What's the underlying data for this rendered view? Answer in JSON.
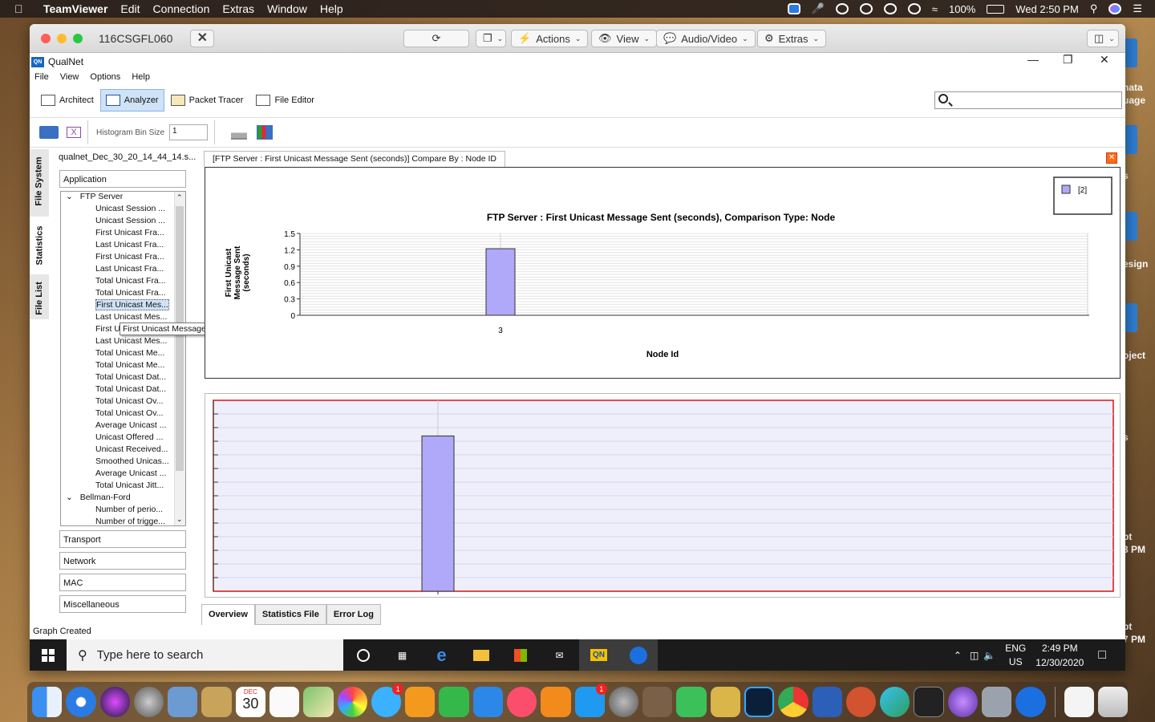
{
  "mac_menubar": {
    "app": "TeamViewer",
    "items": [
      "Edit",
      "Connection",
      "Extras",
      "Window",
      "Help"
    ],
    "battery": "100%",
    "clock": "Wed 2:50 PM"
  },
  "desktop_labels": [
    "nata",
    "uage",
    "s",
    "esign",
    "oject",
    "s",
    "pt",
    "3 PM",
    "pt",
    "7 PM"
  ],
  "teamviewer": {
    "title": "116CSGFL060",
    "toolbar": {
      "actions": "Actions",
      "view": "View",
      "audio_video": "Audio/Video",
      "extras": "Extras"
    }
  },
  "qualnet": {
    "title": "QualNet",
    "menu": [
      "File",
      "View",
      "Options",
      "Help"
    ],
    "tabs": [
      "Architect",
      "Analyzer",
      "Packet Tracer",
      "File Editor"
    ],
    "active_tab": "Analyzer",
    "histogram_label": "Histogram Bin Size",
    "histogram_value": "1",
    "vertical_tabs": [
      "File System",
      "Statistics",
      "File List"
    ],
    "file_name": "qualnet_Dec_30_20_14_44_14.s...",
    "sections": {
      "application": "Application",
      "transport": "Transport",
      "network": "Network",
      "mac": "MAC",
      "misc": "Miscellaneous"
    },
    "tree": [
      {
        "type": "grp",
        "label": "FTP Server"
      },
      {
        "type": "leaf",
        "label": "Unicast Session ..."
      },
      {
        "type": "leaf",
        "label": "Unicast Session ..."
      },
      {
        "type": "leaf",
        "label": "First Unicast Fra..."
      },
      {
        "type": "leaf",
        "label": "Last Unicast Fra..."
      },
      {
        "type": "leaf",
        "label": "First Unicast Fra..."
      },
      {
        "type": "leaf",
        "label": "Last Unicast Fra..."
      },
      {
        "type": "leaf",
        "label": "Total Unicast Fra..."
      },
      {
        "type": "leaf",
        "label": "Total Unicast Fra..."
      },
      {
        "type": "leaf",
        "label": "First Unicast Mes...",
        "selected": true
      },
      {
        "type": "leaf",
        "label": "Last Unicast Mes..."
      },
      {
        "type": "leaf",
        "label": "First U"
      },
      {
        "type": "leaf",
        "label": "Last Unicast Mes..."
      },
      {
        "type": "leaf",
        "label": "Total Unicast Me..."
      },
      {
        "type": "leaf",
        "label": "Total Unicast Me..."
      },
      {
        "type": "leaf",
        "label": "Total Unicast Dat..."
      },
      {
        "type": "leaf",
        "label": "Total Unicast Dat..."
      },
      {
        "type": "leaf",
        "label": "Total Unicast Ov..."
      },
      {
        "type": "leaf",
        "label": "Total Unicast Ov..."
      },
      {
        "type": "leaf",
        "label": "Average Unicast ..."
      },
      {
        "type": "leaf",
        "label": "Unicast Offered ..."
      },
      {
        "type": "leaf",
        "label": "Unicast Received..."
      },
      {
        "type": "leaf",
        "label": "Smoothed Unicas..."
      },
      {
        "type": "leaf",
        "label": "Average Unicast ..."
      },
      {
        "type": "leaf",
        "label": "Total Unicast Jitt..."
      },
      {
        "type": "grp",
        "label": "Bellman-Ford"
      },
      {
        "type": "leaf",
        "label": "Number of perio..."
      },
      {
        "type": "leaf",
        "label": "Number of trigge..."
      }
    ],
    "tooltip": "First Unicast Message Sent (seconds)",
    "doc_tab": "[FTP Server :  First Unicast Message Sent (seconds)] Compare By : Node ID",
    "bottom_tabs": [
      "Overview",
      "Statistics File",
      "Error Log"
    ],
    "status": "Graph Created"
  },
  "chart_data": {
    "type": "bar",
    "title": "FTP Server :  First Unicast Message Sent (seconds), Comparison Type: Node",
    "xlabel": "Node Id",
    "ylabel": "First Unicast Message Sent (seconds)",
    "categories": [
      "3"
    ],
    "series": [
      {
        "name": "[2]",
        "values": [
          1.22
        ]
      }
    ],
    "yticks": [
      "0",
      "0.3",
      "0.6",
      "0.9",
      "1.2",
      "1.5"
    ],
    "ylim": [
      0,
      1.5
    ],
    "bar_color": "#b0a8f8",
    "grid": true,
    "legend": "top-right"
  },
  "windows_taskbar": {
    "search_placeholder": "Type here to search",
    "lang_top": "ENG",
    "lang_bottom": "US",
    "time": "2:49 PM",
    "date": "12/30/2020"
  },
  "dock": {
    "calendar_month": "DEC",
    "calendar_day": "30",
    "badge_messages": "1",
    "badge_appstore": "1"
  }
}
